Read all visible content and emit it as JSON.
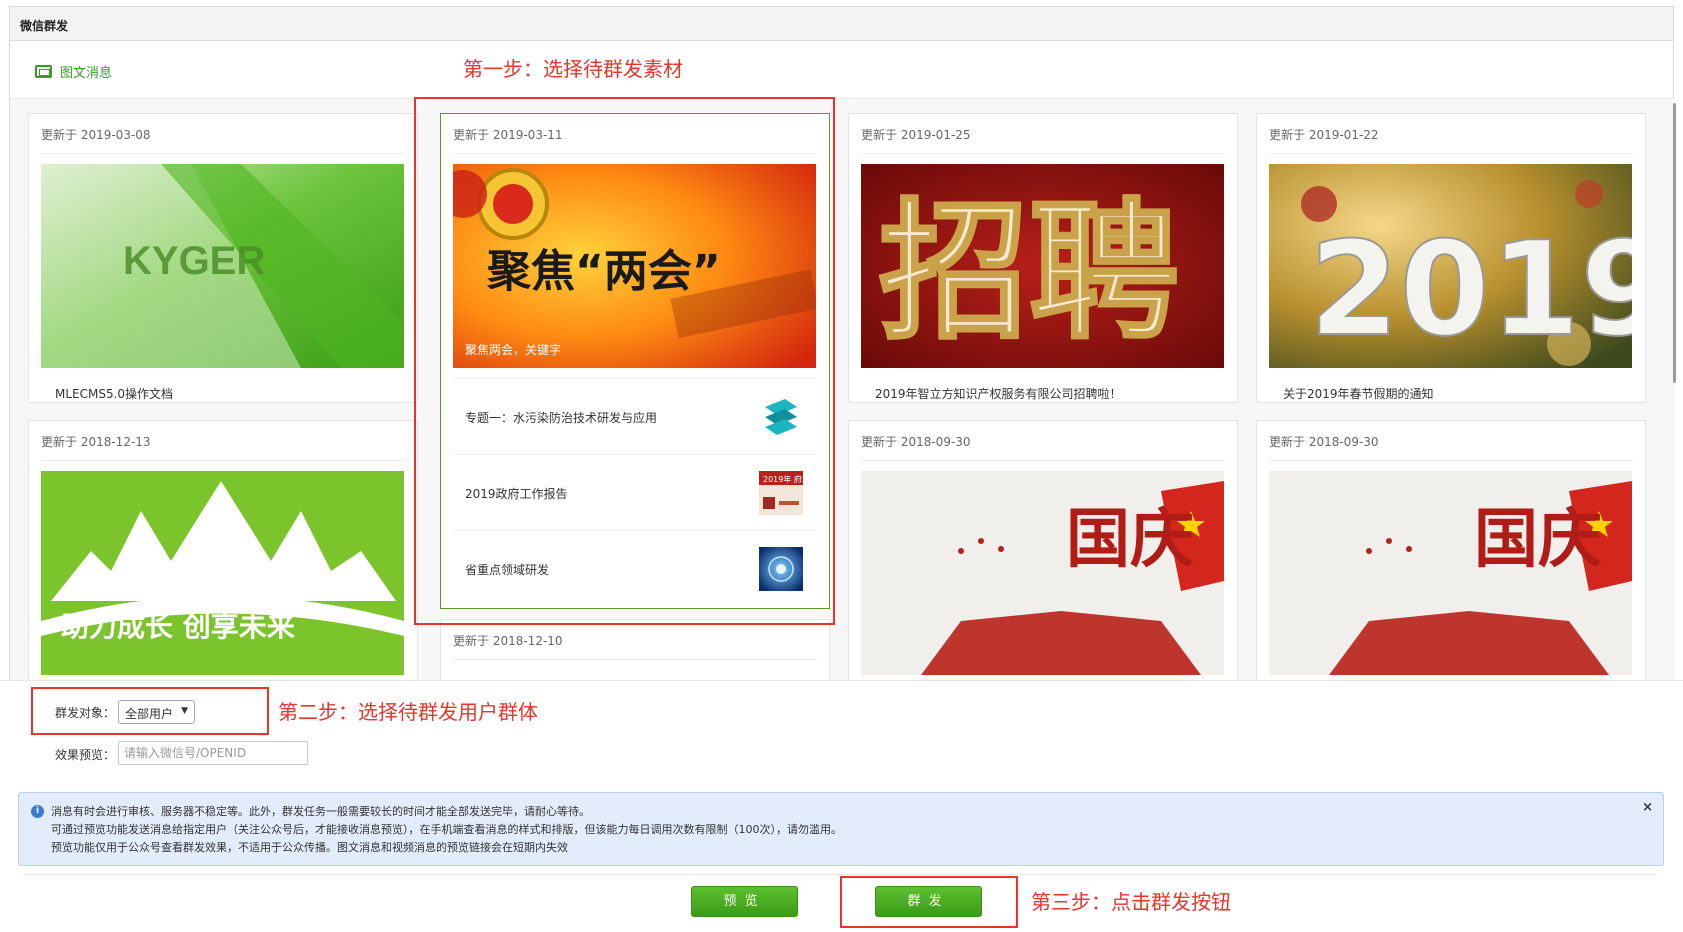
{
  "panel": {
    "title": "微信群发"
  },
  "tab": {
    "label": "图文消息",
    "icon": "news-icon"
  },
  "steps": {
    "step1": "第一步：选择待群发素材",
    "step2": "第二步：选择待群发用户群体",
    "step3": "第三步：点击群发按钮"
  },
  "cards": [
    {
      "date": "更新于 2019-03-08",
      "title": "MLECMS5.0操作文档",
      "cover_text": "KYGER"
    },
    {
      "date": "更新于 2019-03-11",
      "cover_caption": "聚焦两会，关键字",
      "cover_text": "聚焦“两会”",
      "sub_items": [
        {
          "title": "专题一：水污染防治技术研发与应用"
        },
        {
          "title": "2019政府工作报告",
          "thumb_text": "2019年 府工作报"
        },
        {
          "title": "省重点领域研发"
        }
      ]
    },
    {
      "date": "更新于 2019-01-25",
      "title": "2019年智立方知识产权服务有限公司招聘啦！",
      "cover_text": "招聘"
    },
    {
      "date": "更新于 2019-01-22",
      "title": "关于2019年春节假期的通知",
      "cover_text": "2019"
    },
    {
      "date": "更新于 2018-12-13",
      "cover_text": "助力成长 创享未来"
    },
    {
      "date": "更新于 2018-12-10"
    },
    {
      "date": "更新于 2018-09-30",
      "cover_text": "国庆"
    },
    {
      "date": "更新于 2018-09-30",
      "cover_text": "国庆"
    }
  ],
  "form": {
    "target_label": "群发对象：",
    "target_value": "全部用户",
    "preview_label": "效果预览：",
    "preview_placeholder": "请输入微信号/OPENID"
  },
  "notice": {
    "lines": [
      "消息有时会进行审核、服务器不稳定等。此外，群发任务一般需要较长的时间才能全部发送完毕，请耐心等待。",
      "可通过预览功能发送消息给指定用户（关注公众号后，才能接收消息预览），在手机端查看消息的样式和排版，但该能力每日调用次数有限制（100次），请勿滥用。",
      "预览功能仅用于公众号查看群发效果，不适用于公众传播。图文消息和视频消息的预览链接会在短期内失效"
    ],
    "close": "×"
  },
  "buttons": {
    "preview": "预览",
    "send": "群发"
  },
  "colors": {
    "accent_green": "#3a9a2a",
    "step_red": "#e8352b",
    "notice_bg": "#e2ecfb"
  }
}
